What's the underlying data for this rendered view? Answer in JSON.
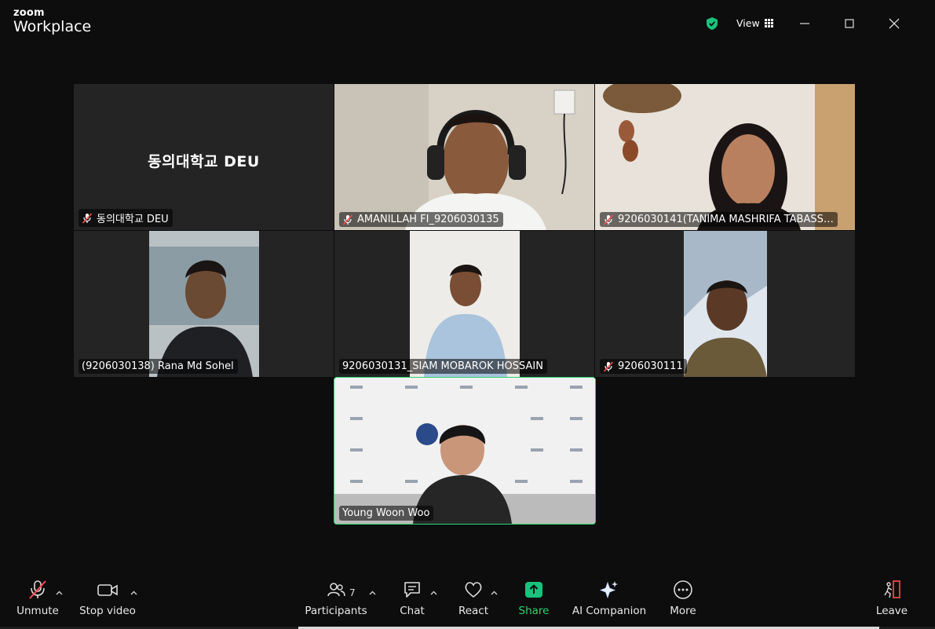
{
  "app": {
    "logo_top": "zoom",
    "logo_bottom": "Workplace"
  },
  "titlebar": {
    "view_label": "View"
  },
  "tiles": [
    {
      "name": "동의대학교 DEU",
      "placeholder": "동의대학교 DEU",
      "muted": true
    },
    {
      "name": "AMANILLAH FI_9206030135",
      "muted": true
    },
    {
      "name": "9206030141(TANIMA MASHRIFA TABASS…",
      "muted": true
    },
    {
      "name": "(9206030138) Rana Md Sohel",
      "muted": false
    },
    {
      "name": "9206030131_SIAM MOBAROK HOSSAIN",
      "muted": false
    },
    {
      "name": "9206030111",
      "muted": true
    },
    {
      "name": "Young Woon Woo",
      "muted": false,
      "active_speaker": true
    }
  ],
  "toolbar": {
    "unmute": "Unmute",
    "stop_video": "Stop video",
    "participants": "Participants",
    "participants_count": "7",
    "chat": "Chat",
    "react": "React",
    "share": "Share",
    "ai_companion": "AI Companion",
    "more": "More",
    "leave": "Leave"
  },
  "colors": {
    "accent_green": "#2dd36f",
    "share_green": "#19c37d",
    "leave_red": "#e5484d",
    "mute_red": "#ff4d4f"
  }
}
